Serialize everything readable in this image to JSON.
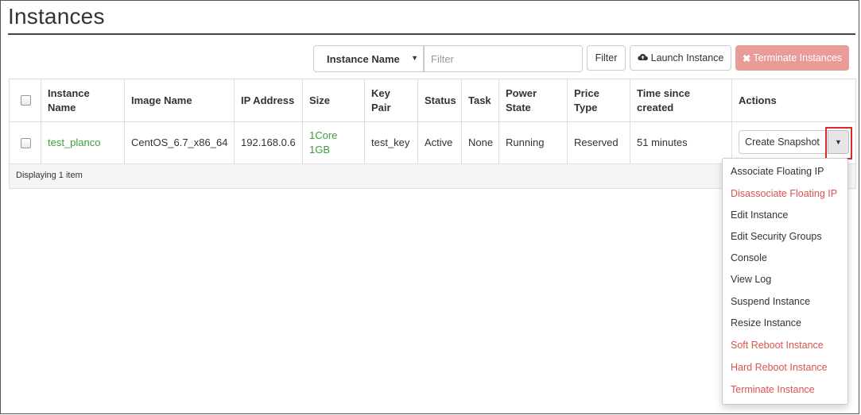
{
  "page": {
    "title": "Instances"
  },
  "toolbar": {
    "select_value": "Instance Name",
    "filter_placeholder": "Filter",
    "filter_button": "Filter",
    "launch_button": "Launch Instance",
    "terminate_button": "Terminate Instances",
    "launch_icon": "cloud-upload-icon",
    "terminate_icon": "close-icon"
  },
  "table": {
    "headers": {
      "instance_name": [
        "Instance",
        "Name"
      ],
      "image_name": "Image Name",
      "ip_address": "IP Address",
      "size": "Size",
      "key_pair": [
        "Key",
        "Pair"
      ],
      "status": "Status",
      "task": "Task",
      "power_state": [
        "Power",
        "State"
      ],
      "price_type": [
        "Price",
        "Type"
      ],
      "time_since_created": [
        "Time since",
        "created"
      ],
      "actions": "Actions"
    },
    "rows": [
      {
        "instance_name": "test_planco",
        "image_name": "CentOS_6.7_x86_64",
        "ip_address": "192.168.0.6",
        "size_line1": "1Core",
        "size_line2": "1GB",
        "key_pair": "test_key",
        "status": "Active",
        "task": "None",
        "power_state": "Running",
        "price_type": "Reserved",
        "time_since_created": "51 minutes",
        "action_button": "Create Snapshot"
      }
    ],
    "footer": "Displaying 1 item"
  },
  "actions_menu": {
    "items": [
      {
        "label": "Associate Floating IP",
        "danger": false
      },
      {
        "label": "Disassociate Floating IP",
        "danger": true
      },
      {
        "label": "Edit Instance",
        "danger": false
      },
      {
        "label": "Edit Security Groups",
        "danger": false
      },
      {
        "label": "Console",
        "danger": false
      },
      {
        "label": "View Log",
        "danger": false
      },
      {
        "label": "Suspend Instance",
        "danger": false
      },
      {
        "label": "Resize Instance",
        "danger": false
      },
      {
        "label": "Soft Reboot Instance",
        "danger": true
      },
      {
        "label": "Hard Reboot Instance",
        "danger": true
      },
      {
        "label": "Terminate Instance",
        "danger": true
      }
    ]
  },
  "colors": {
    "link_green": "#3c9e3c",
    "danger_red": "#d9534f",
    "terminate_button_bg": "#e89b97",
    "highlight_border": "#d9282e"
  }
}
